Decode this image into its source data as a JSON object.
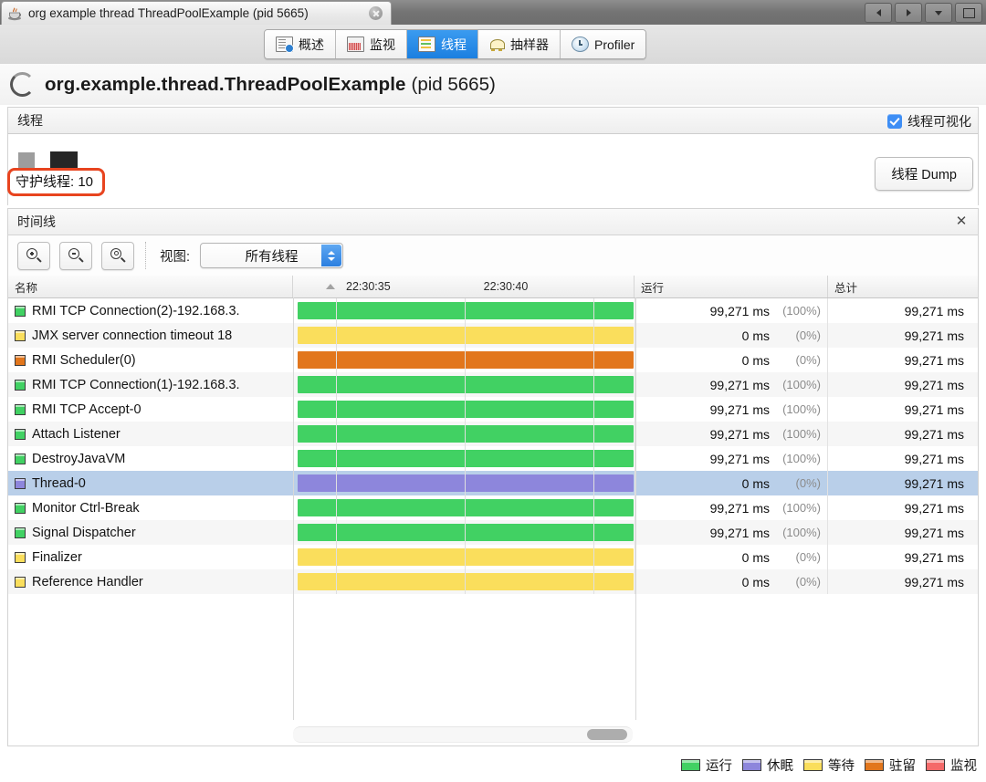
{
  "window": {
    "tab_title": "org example thread ThreadPoolExample (pid 5665)",
    "java_icon": "java-cup-icon",
    "close_icon": "close-icon",
    "controls": [
      {
        "name": "nav-back-button",
        "icon": "triangle-left-icon"
      },
      {
        "name": "nav-forward-button",
        "icon": "triangle-right-icon"
      },
      {
        "name": "dropdown-button",
        "icon": "chevron-down-icon"
      },
      {
        "name": "maximize-button",
        "icon": "square-icon"
      }
    ]
  },
  "tabs": [
    {
      "label": "概述",
      "icon": "overview-icon",
      "active": false
    },
    {
      "label": "监视",
      "icon": "monitor-icon",
      "active": false
    },
    {
      "label": "线程",
      "icon": "thread-icon",
      "active": true
    },
    {
      "label": "抽样器",
      "icon": "sampler-icon",
      "active": false
    },
    {
      "label": "Profiler",
      "icon": "profiler-icon",
      "active": false
    }
  ],
  "header": {
    "spinner_icon": "loading-spinner-icon",
    "app_name": "org.example.thread.ThreadPoolExample",
    "pid": "(pid 5665)"
  },
  "threads_panel": {
    "title": "线程",
    "visualize_label": "线程可视化",
    "visualize_checked": true,
    "daemon_label": "守护线程: 10",
    "dump_button": "线程 Dump",
    "highlight_color": "#e8441f"
  },
  "timeline_panel": {
    "title": "时间线",
    "close_icon": "close-icon",
    "zoom_in": "zoom-in-icon",
    "zoom_out": "zoom-out-icon",
    "zoom_fit": "zoom-fit-icon",
    "view_label": "视图:",
    "view_value": "所有线程",
    "view_options": [
      "所有线程"
    ]
  },
  "table": {
    "columns": [
      "名称",
      "",
      "运行",
      "总计"
    ],
    "ticks": [
      "22:30:35",
      "22:30:40"
    ],
    "rows": [
      {
        "name": "RMI TCP Connection(2)-192.168.3.",
        "state": "running",
        "run": "99,271 ms",
        "pct": "(100%)",
        "total": "99,271 ms",
        "selected": false
      },
      {
        "name": "JMX server connection timeout 18",
        "state": "waiting",
        "run": "0 ms",
        "pct": "(0%)",
        "total": "99,271 ms",
        "selected": false
      },
      {
        "name": "RMI Scheduler(0)",
        "state": "parked",
        "run": "0 ms",
        "pct": "(0%)",
        "total": "99,271 ms",
        "selected": false
      },
      {
        "name": "RMI TCP Connection(1)-192.168.3.",
        "state": "running",
        "run": "99,271 ms",
        "pct": "(100%)",
        "total": "99,271 ms",
        "selected": false
      },
      {
        "name": "RMI TCP Accept-0",
        "state": "running",
        "run": "99,271 ms",
        "pct": "(100%)",
        "total": "99,271 ms",
        "selected": false
      },
      {
        "name": "Attach Listener",
        "state": "running",
        "run": "99,271 ms",
        "pct": "(100%)",
        "total": "99,271 ms",
        "selected": false
      },
      {
        "name": "DestroyJavaVM",
        "state": "running",
        "run": "99,271 ms",
        "pct": "(100%)",
        "total": "99,271 ms",
        "selected": false
      },
      {
        "name": "Thread-0",
        "state": "sleeping",
        "run": "0 ms",
        "pct": "(0%)",
        "total": "99,271 ms",
        "selected": true
      },
      {
        "name": "Monitor Ctrl-Break",
        "state": "running",
        "run": "99,271 ms",
        "pct": "(100%)",
        "total": "99,271 ms",
        "selected": false
      },
      {
        "name": "Signal Dispatcher",
        "state": "running",
        "run": "99,271 ms",
        "pct": "(100%)",
        "total": "99,271 ms",
        "selected": false
      },
      {
        "name": "Finalizer",
        "state": "waiting",
        "run": "0 ms",
        "pct": "(0%)",
        "total": "99,271 ms",
        "selected": false
      },
      {
        "name": "Reference Handler",
        "state": "waiting",
        "run": "0 ms",
        "pct": "(0%)",
        "total": "99,271 ms",
        "selected": false
      }
    ]
  },
  "legend": [
    {
      "label": "运行",
      "color": "#41d163"
    },
    {
      "label": "休眠",
      "color": "#8d86dc"
    },
    {
      "label": "等待",
      "color": "#fade5c"
    },
    {
      "label": "驻留",
      "color": "#e2761c"
    },
    {
      "label": "监视",
      "color": "#f46a6a"
    }
  ],
  "state_colors": {
    "running": "#41d163",
    "sleeping": "#8d86dc",
    "waiting": "#fade5c",
    "parked": "#e2761c",
    "monitor": "#f46a6a"
  }
}
